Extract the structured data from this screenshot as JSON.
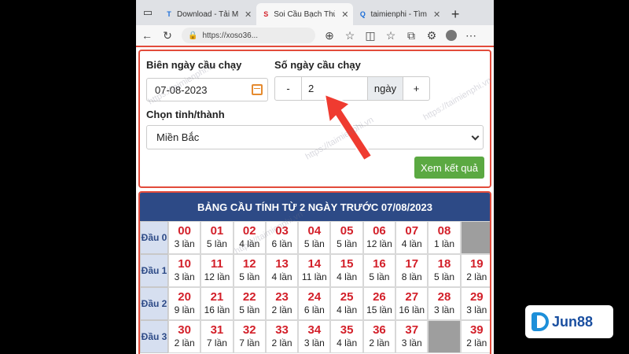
{
  "browser": {
    "tabs": [
      {
        "label": "Download - Tải M",
        "active": false,
        "favicon": "T"
      },
      {
        "label": "Soi Cầu Bạch Thủ",
        "active": true,
        "favicon": "S"
      },
      {
        "label": "taimienphi - Tìm",
        "active": false,
        "favicon": "Q"
      }
    ],
    "url": "https://xoso36..."
  },
  "form": {
    "date_label": "Biên ngày cầu chạy",
    "date_value": "07-08-2023",
    "days_label": "Số ngày cầu chạy",
    "minus_label": "-",
    "days_value": "2",
    "days_unit": "ngày",
    "plus_label": "+",
    "province_label": "Chọn tỉnh/thành",
    "province_value": "Miền Bắc",
    "submit_label": "Xem kết quả"
  },
  "table": {
    "title": "BẢNG CẦU TÍNH TỪ 2 NGÀY TRƯỚC 07/08/2023",
    "rows": [
      {
        "head": "Đầu 0",
        "cells": [
          {
            "n": "00",
            "c": "3 lần"
          },
          {
            "n": "01",
            "c": "5 lần"
          },
          {
            "n": "02",
            "c": "4 lần"
          },
          {
            "n": "03",
            "c": "6 lần"
          },
          {
            "n": "04",
            "c": "5 lần"
          },
          {
            "n": "05",
            "c": "5 lần"
          },
          {
            "n": "06",
            "c": "12 lần"
          },
          {
            "n": "07",
            "c": "4 lần"
          },
          {
            "n": "08",
            "c": "1 lần"
          },
          {
            "n": "",
            "c": ""
          }
        ]
      },
      {
        "head": "Đầu 1",
        "cells": [
          {
            "n": "10",
            "c": "3 lần"
          },
          {
            "n": "11",
            "c": "12 lần"
          },
          {
            "n": "12",
            "c": "5 lần"
          },
          {
            "n": "13",
            "c": "4 lần"
          },
          {
            "n": "14",
            "c": "11 lần"
          },
          {
            "n": "15",
            "c": "4 lần"
          },
          {
            "n": "16",
            "c": "5 lần"
          },
          {
            "n": "17",
            "c": "8 lần"
          },
          {
            "n": "18",
            "c": "5 lần"
          },
          {
            "n": "19",
            "c": "2 lần"
          }
        ]
      },
      {
        "head": "Đầu 2",
        "cells": [
          {
            "n": "20",
            "c": "9 lần"
          },
          {
            "n": "21",
            "c": "16 lần"
          },
          {
            "n": "22",
            "c": "5 lần"
          },
          {
            "n": "23",
            "c": "2 lần"
          },
          {
            "n": "24",
            "c": "6 lần"
          },
          {
            "n": "25",
            "c": "4 lần"
          },
          {
            "n": "26",
            "c": "15 lần"
          },
          {
            "n": "27",
            "c": "16 lần"
          },
          {
            "n": "28",
            "c": "3 lần"
          },
          {
            "n": "29",
            "c": "3 lần"
          }
        ]
      },
      {
        "head": "Đầu 3",
        "cells": [
          {
            "n": "30",
            "c": "2 lần"
          },
          {
            "n": "31",
            "c": "7 lần"
          },
          {
            "n": "32",
            "c": "7 lần"
          },
          {
            "n": "33",
            "c": "2 lần"
          },
          {
            "n": "34",
            "c": "3 lần"
          },
          {
            "n": "35",
            "c": "4 lần"
          },
          {
            "n": "36",
            "c": "2 lần"
          },
          {
            "n": "37",
            "c": "3 lần"
          },
          {
            "n": "",
            "c": ""
          },
          {
            "n": "39",
            "c": "2 lần"
          }
        ]
      }
    ]
  },
  "watermark": "https://taimienphi.vn",
  "logo": {
    "text": "Jun88"
  },
  "colors": {
    "accent_red": "#d3202a",
    "header_blue": "#2d4a86",
    "button_green": "#5ba942"
  }
}
